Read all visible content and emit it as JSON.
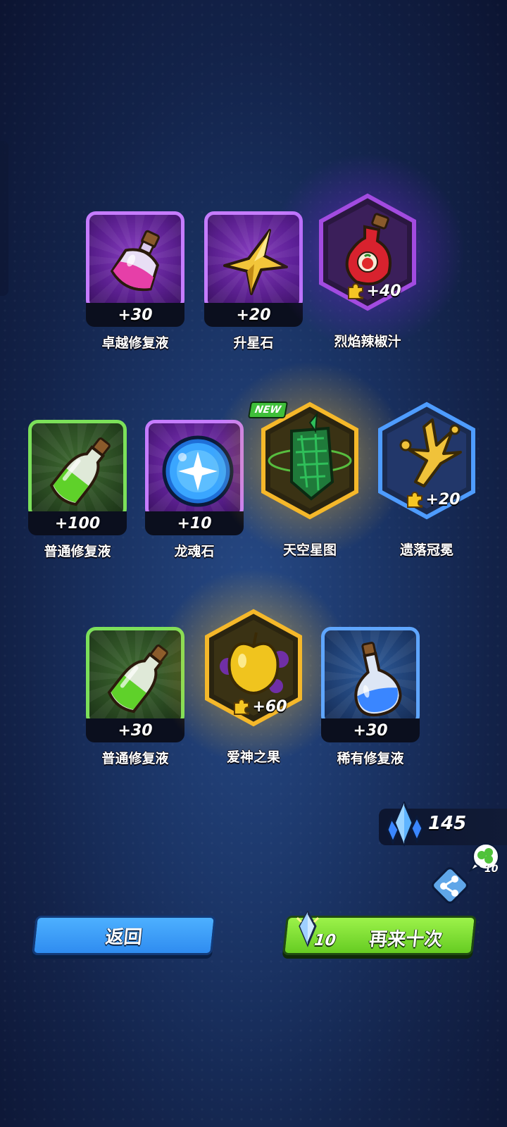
{
  "rewards": [
    {
      "name": "卓越修复液",
      "qty": "+30",
      "frame": "purple",
      "icon": "pink-potion-icon"
    },
    {
      "name": "升星石",
      "qty": "+20",
      "frame": "purple",
      "icon": "star-stone-icon"
    },
    {
      "name": "烈焰辣椒汁",
      "qty": "+40",
      "frame": "hex-purple",
      "icon": "chili-sauce-bottle-icon"
    },
    {
      "name": "普通修复液",
      "qty": "+100",
      "frame": "green",
      "icon": "green-potion-icon"
    },
    {
      "name": "龙魂石",
      "qty": "+10",
      "frame": "purple",
      "icon": "dragon-soul-orb-icon"
    },
    {
      "name": "天空星图",
      "qty": "",
      "frame": "hex-gold",
      "icon": "star-map-shard-icon",
      "badge": "NEW"
    },
    {
      "name": "遗落冠冕",
      "qty": "+20",
      "frame": "hex-blue",
      "icon": "golden-crown-icon"
    },
    {
      "name": "普通修复液",
      "qty": "+30",
      "frame": "green",
      "icon": "green-potion-icon"
    },
    {
      "name": "爱神之果",
      "qty": "+60",
      "frame": "hex-gold",
      "icon": "golden-apple-icon"
    },
    {
      "name": "稀有修复液",
      "qty": "+30",
      "frame": "blue",
      "icon": "blue-potion-icon"
    }
  ],
  "currency": {
    "amount": "145",
    "icon": "blue-crystal-icon"
  },
  "share": {
    "bubble_count": "10",
    "icon": "share-icon"
  },
  "buttons": {
    "back_label": "返回",
    "again_label": "再来十次",
    "again_cost": "10"
  },
  "colors": {
    "purple_frame": "#c67cff",
    "green_frame": "#7ce05a",
    "blue_frame": "#5fa6ff",
    "gold_glow": "#ffd23a",
    "back_button": "#3a9cf6",
    "again_button": "#7edc34"
  }
}
